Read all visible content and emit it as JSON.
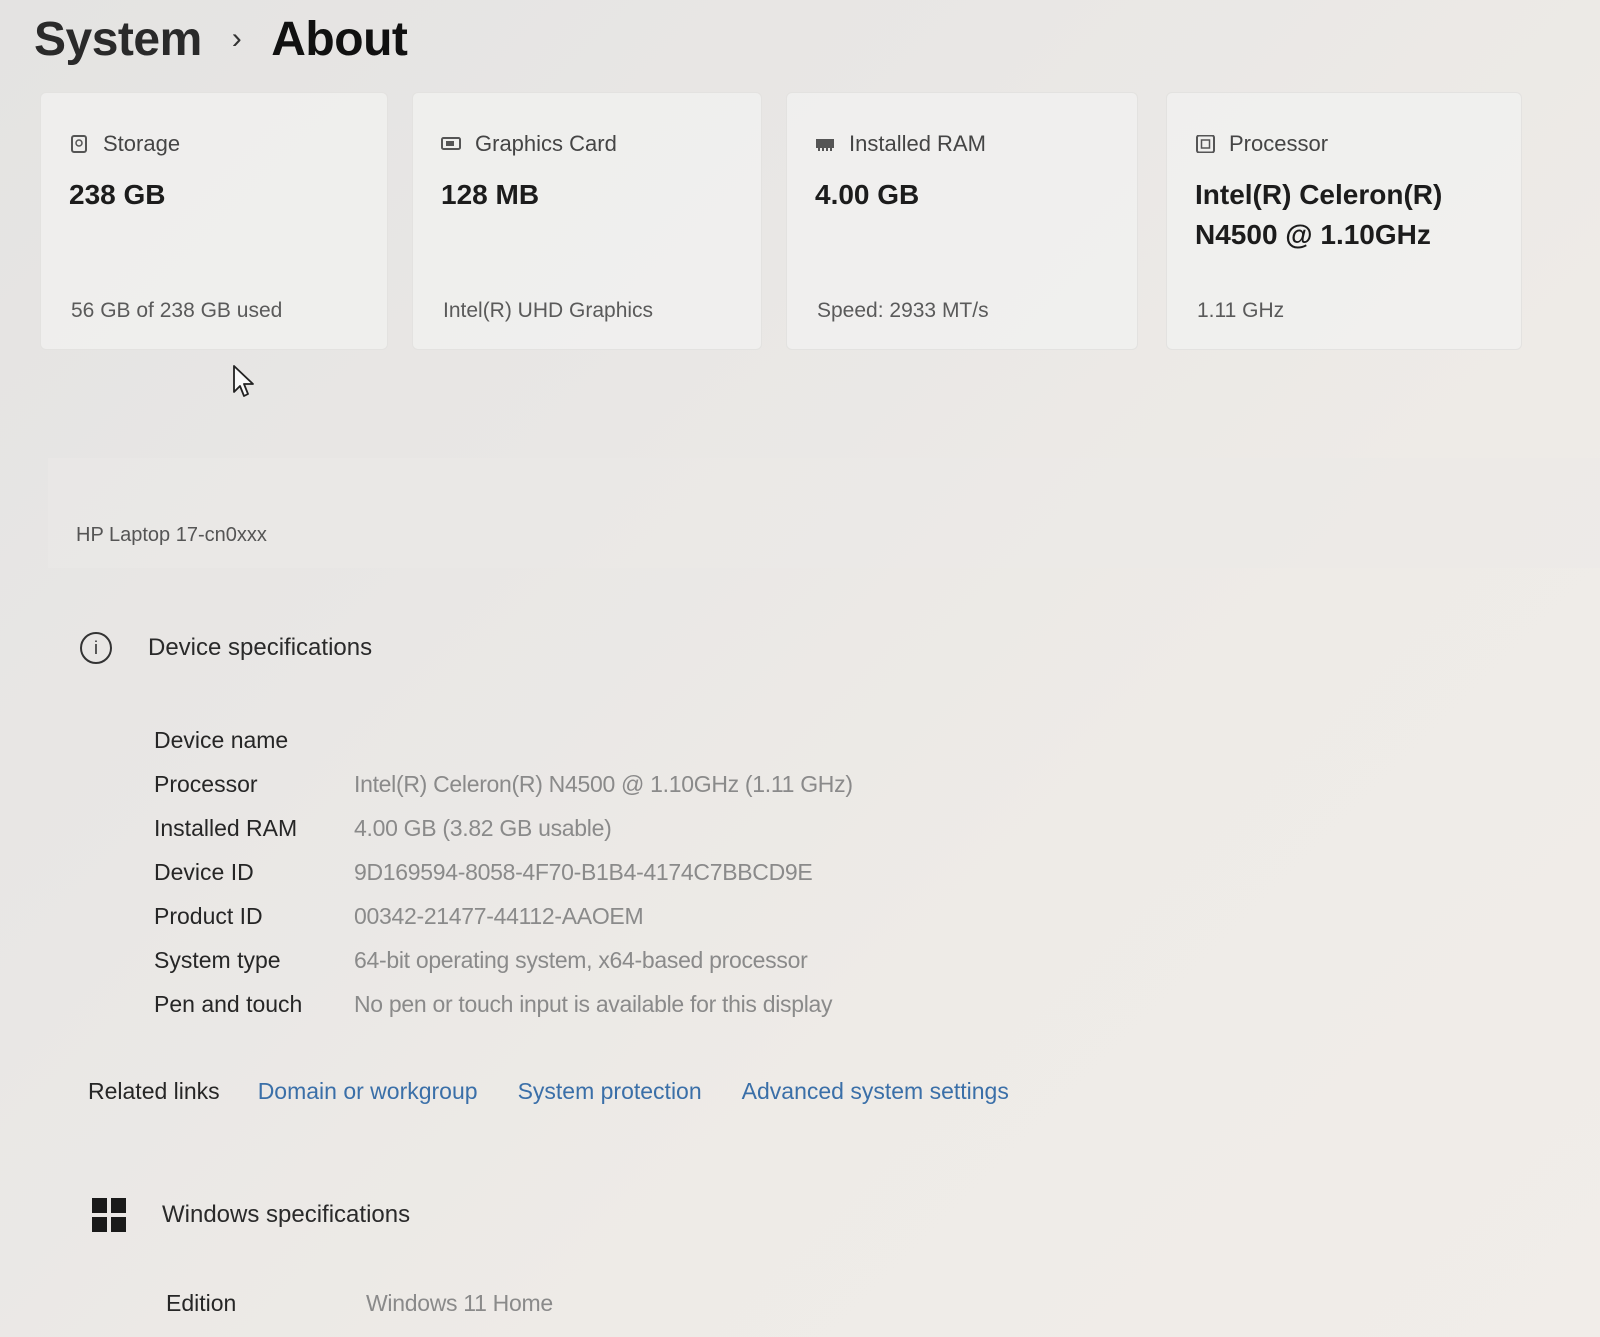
{
  "breadcrumb": {
    "parent": "System",
    "separator": "›",
    "current": "About"
  },
  "cards": [
    {
      "title": "Storage",
      "value": "238 GB",
      "detail": "56 GB of 238 GB used",
      "icon": "storage-icon"
    },
    {
      "title": "Graphics Card",
      "value": "128 MB",
      "detail": "Intel(R) UHD Graphics",
      "icon": "graphics-card-icon"
    },
    {
      "title": "Installed RAM",
      "value": "4.00 GB",
      "detail": "Speed: 2933 MT/s",
      "icon": "ram-icon"
    },
    {
      "title": "Processor",
      "value_line1": "Intel(R) Celeron(R)",
      "value_line2": "N4500 @ 1.10GHz",
      "detail": "1.11 GHz",
      "icon": "processor-icon"
    }
  ],
  "device_model": "HP Laptop 17-cn0xxx",
  "device_specs": {
    "title": "Device specifications",
    "rows": [
      {
        "label": "Device name",
        "value": ""
      },
      {
        "label": "Processor",
        "value": "Intel(R) Celeron(R) N4500 @ 1.10GHz (1.11 GHz)"
      },
      {
        "label": "Installed RAM",
        "value": "4.00 GB (3.82 GB usable)"
      },
      {
        "label": "Device ID",
        "value": "9D169594-8058-4F70-B1B4-4174C7BBCD9E"
      },
      {
        "label": "Product ID",
        "value": "00342-21477-44112-AAOEM"
      },
      {
        "label": "System type",
        "value": "64-bit operating system, x64-based processor"
      },
      {
        "label": "Pen and touch",
        "value": "No pen or touch input is available for this display"
      }
    ]
  },
  "related_links": {
    "label": "Related links",
    "links": [
      "Domain or workgroup",
      "System protection",
      "Advanced system settings"
    ]
  },
  "windows_specs": {
    "title": "Windows specifications",
    "edition_label": "Edition",
    "edition_value": "Windows 11 Home"
  },
  "colors": {
    "link": "#3a6fa8",
    "muted_value": "#8a8a8a"
  }
}
